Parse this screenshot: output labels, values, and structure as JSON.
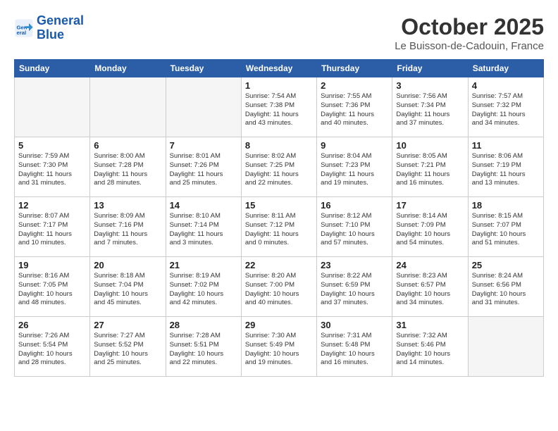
{
  "logo": {
    "line1": "General",
    "line2": "Blue"
  },
  "title": "October 2025",
  "subtitle": "Le Buisson-de-Cadouin, France",
  "weekdays": [
    "Sunday",
    "Monday",
    "Tuesday",
    "Wednesday",
    "Thursday",
    "Friday",
    "Saturday"
  ],
  "weeks": [
    [
      {
        "day": "",
        "info": ""
      },
      {
        "day": "",
        "info": ""
      },
      {
        "day": "",
        "info": ""
      },
      {
        "day": "1",
        "info": "Sunrise: 7:54 AM\nSunset: 7:38 PM\nDaylight: 11 hours\nand 43 minutes."
      },
      {
        "day": "2",
        "info": "Sunrise: 7:55 AM\nSunset: 7:36 PM\nDaylight: 11 hours\nand 40 minutes."
      },
      {
        "day": "3",
        "info": "Sunrise: 7:56 AM\nSunset: 7:34 PM\nDaylight: 11 hours\nand 37 minutes."
      },
      {
        "day": "4",
        "info": "Sunrise: 7:57 AM\nSunset: 7:32 PM\nDaylight: 11 hours\nand 34 minutes."
      }
    ],
    [
      {
        "day": "5",
        "info": "Sunrise: 7:59 AM\nSunset: 7:30 PM\nDaylight: 11 hours\nand 31 minutes."
      },
      {
        "day": "6",
        "info": "Sunrise: 8:00 AM\nSunset: 7:28 PM\nDaylight: 11 hours\nand 28 minutes."
      },
      {
        "day": "7",
        "info": "Sunrise: 8:01 AM\nSunset: 7:26 PM\nDaylight: 11 hours\nand 25 minutes."
      },
      {
        "day": "8",
        "info": "Sunrise: 8:02 AM\nSunset: 7:25 PM\nDaylight: 11 hours\nand 22 minutes."
      },
      {
        "day": "9",
        "info": "Sunrise: 8:04 AM\nSunset: 7:23 PM\nDaylight: 11 hours\nand 19 minutes."
      },
      {
        "day": "10",
        "info": "Sunrise: 8:05 AM\nSunset: 7:21 PM\nDaylight: 11 hours\nand 16 minutes."
      },
      {
        "day": "11",
        "info": "Sunrise: 8:06 AM\nSunset: 7:19 PM\nDaylight: 11 hours\nand 13 minutes."
      }
    ],
    [
      {
        "day": "12",
        "info": "Sunrise: 8:07 AM\nSunset: 7:17 PM\nDaylight: 11 hours\nand 10 minutes."
      },
      {
        "day": "13",
        "info": "Sunrise: 8:09 AM\nSunset: 7:16 PM\nDaylight: 11 hours\nand 7 minutes."
      },
      {
        "day": "14",
        "info": "Sunrise: 8:10 AM\nSunset: 7:14 PM\nDaylight: 11 hours\nand 3 minutes."
      },
      {
        "day": "15",
        "info": "Sunrise: 8:11 AM\nSunset: 7:12 PM\nDaylight: 11 hours\nand 0 minutes."
      },
      {
        "day": "16",
        "info": "Sunrise: 8:12 AM\nSunset: 7:10 PM\nDaylight: 10 hours\nand 57 minutes."
      },
      {
        "day": "17",
        "info": "Sunrise: 8:14 AM\nSunset: 7:09 PM\nDaylight: 10 hours\nand 54 minutes."
      },
      {
        "day": "18",
        "info": "Sunrise: 8:15 AM\nSunset: 7:07 PM\nDaylight: 10 hours\nand 51 minutes."
      }
    ],
    [
      {
        "day": "19",
        "info": "Sunrise: 8:16 AM\nSunset: 7:05 PM\nDaylight: 10 hours\nand 48 minutes."
      },
      {
        "day": "20",
        "info": "Sunrise: 8:18 AM\nSunset: 7:04 PM\nDaylight: 10 hours\nand 45 minutes."
      },
      {
        "day": "21",
        "info": "Sunrise: 8:19 AM\nSunset: 7:02 PM\nDaylight: 10 hours\nand 42 minutes."
      },
      {
        "day": "22",
        "info": "Sunrise: 8:20 AM\nSunset: 7:00 PM\nDaylight: 10 hours\nand 40 minutes."
      },
      {
        "day": "23",
        "info": "Sunrise: 8:22 AM\nSunset: 6:59 PM\nDaylight: 10 hours\nand 37 minutes."
      },
      {
        "day": "24",
        "info": "Sunrise: 8:23 AM\nSunset: 6:57 PM\nDaylight: 10 hours\nand 34 minutes."
      },
      {
        "day": "25",
        "info": "Sunrise: 8:24 AM\nSunset: 6:56 PM\nDaylight: 10 hours\nand 31 minutes."
      }
    ],
    [
      {
        "day": "26",
        "info": "Sunrise: 7:26 AM\nSunset: 5:54 PM\nDaylight: 10 hours\nand 28 minutes."
      },
      {
        "day": "27",
        "info": "Sunrise: 7:27 AM\nSunset: 5:52 PM\nDaylight: 10 hours\nand 25 minutes."
      },
      {
        "day": "28",
        "info": "Sunrise: 7:28 AM\nSunset: 5:51 PM\nDaylight: 10 hours\nand 22 minutes."
      },
      {
        "day": "29",
        "info": "Sunrise: 7:30 AM\nSunset: 5:49 PM\nDaylight: 10 hours\nand 19 minutes."
      },
      {
        "day": "30",
        "info": "Sunrise: 7:31 AM\nSunset: 5:48 PM\nDaylight: 10 hours\nand 16 minutes."
      },
      {
        "day": "31",
        "info": "Sunrise: 7:32 AM\nSunset: 5:46 PM\nDaylight: 10 hours\nand 14 minutes."
      },
      {
        "day": "",
        "info": ""
      }
    ]
  ]
}
